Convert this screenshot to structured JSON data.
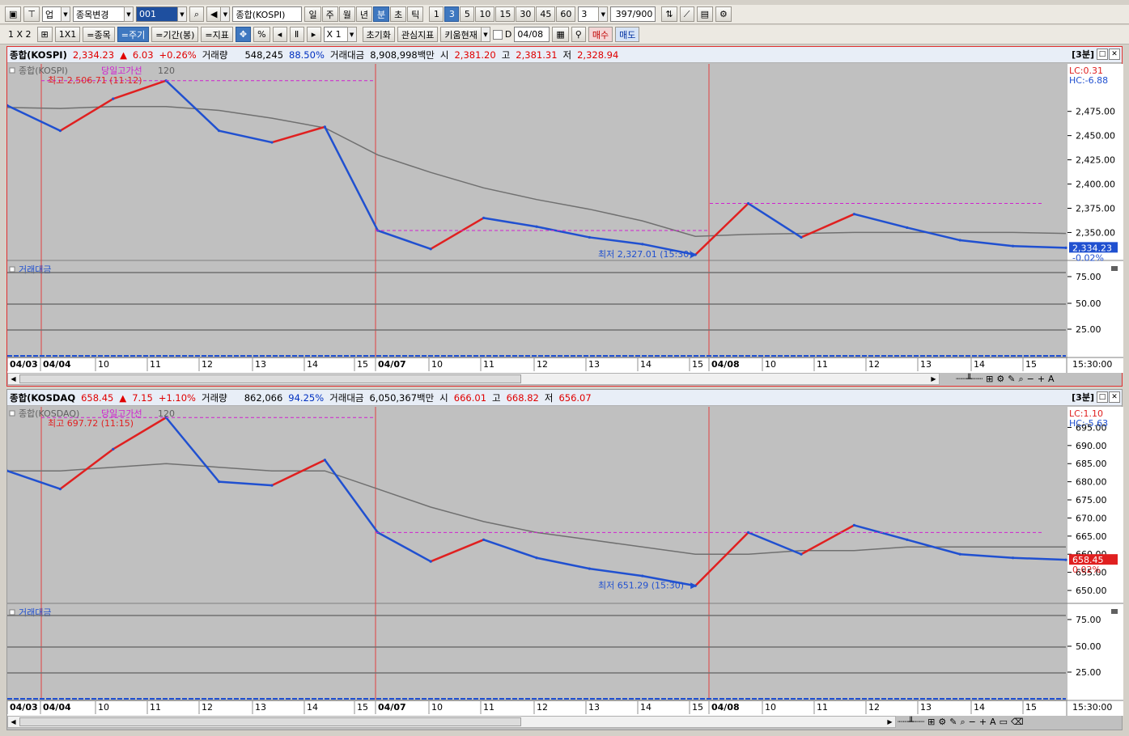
{
  "toolbar1": {
    "layout_icons": [
      "window-icon",
      "pin-icon"
    ],
    "market_type": "업",
    "code_change_label": "종목변경",
    "code_value": "001",
    "index_name": "종합(KOSPI)",
    "period_buttons": [
      "일",
      "주",
      "월",
      "년",
      "분",
      "초",
      "틱"
    ],
    "active_period": "분",
    "interval_buttons": [
      "1",
      "3",
      "5",
      "10",
      "15",
      "30",
      "45",
      "60"
    ],
    "active_interval": "3",
    "interval_select": "3",
    "count_value": "397",
    "count_total": "/900"
  },
  "toolbar2": {
    "grid_label": "1 X 2",
    "one_by_one": "1X1",
    "btn_stock": "=종목",
    "btn_period": "=주기",
    "btn_range": "=기간(봉)",
    "btn_indicator": "=지표",
    "percent_label": "%",
    "multiplier": "X 1",
    "reset_label": "초기화",
    "interest_label": "관심지표",
    "kiwoom_label": "키움현재",
    "d_label": "D",
    "date_value": "04/08",
    "buy_label": "매수",
    "sell_label": "매도"
  },
  "panels": [
    {
      "info": {
        "name": "종합(KOSPI)",
        "price": "2,334.23",
        "arrow": "▲",
        "change": "6.03",
        "change_pct": "+0.26%",
        "volume_label": "거래량",
        "volume": "548,245",
        "volume_ratio": "88.50%",
        "amount_label": "거래대금",
        "amount": "8,908,998백만",
        "open_label": "시",
        "open": "2,381.20",
        "high_label": "고",
        "high": "2,381.31",
        "low_label": "저",
        "low": "2,328.94",
        "period_tag": "[3분]"
      },
      "legend": {
        "series_name": "종합(KOSPI)",
        "line_name": "당일고가선",
        "ma": "120"
      },
      "hi_note": "최고 2,506.71 (11:12)",
      "lo_note": "최저 2,327.01 (15:30)",
      "lc_label": "LC:0.31",
      "hc_label": "HC:-6.88",
      "current_tag": "2,334.23",
      "current_pct": "-0.02%",
      "price_ticks": [
        "2,475.00",
        "2,450.00",
        "2,425.00",
        "2,400.00",
        "2,375.00",
        "2,350.00"
      ],
      "sub_label": "거래대금",
      "sub_ticks": [
        "75.00",
        "50.00",
        "25.00"
      ],
      "time_label": "15:30:00"
    },
    {
      "info": {
        "name": "종합(KOSDAQ",
        "price": "658.45",
        "arrow": "▲",
        "change": "7.15",
        "change_pct": "+1.10%",
        "volume_label": "거래량",
        "volume": "862,066",
        "volume_ratio": "94.25%",
        "amount_label": "거래대금",
        "amount": "6,050,367백만",
        "open_label": "시",
        "open": "666.01",
        "high_label": "고",
        "high": "668.82",
        "low_label": "저",
        "low": "656.07",
        "period_tag": "[3분]"
      },
      "legend": {
        "series_name": "종합(KOSDAQ)",
        "line_name": "당일고가선",
        "ma": "120"
      },
      "hi_note": "최고 697.72 (11:15)",
      "lo_note": "최저 651.29 (15:30)",
      "lc_label": "LC:1.10",
      "hc_label": "HC:-5.63",
      "current_tag": "658.45",
      "current_pct": "0.02%",
      "price_ticks": [
        "695.00",
        "690.00",
        "685.00",
        "680.00",
        "675.00",
        "670.00",
        "665.00",
        "660.00",
        "655.00",
        "650.00"
      ],
      "sub_label": "거래대금",
      "sub_ticks": [
        "75.00",
        "50.00",
        "25.00"
      ],
      "time_label": "15:30:00"
    }
  ],
  "x_axis_labels": [
    "04/03",
    "04/04",
    "10",
    "11",
    "12",
    "13",
    "14",
    "15",
    "04/07",
    "10",
    "11",
    "12",
    "13",
    "14",
    "15",
    "04/08",
    "10",
    "11",
    "12",
    "13",
    "14",
    "15"
  ],
  "colors": {
    "up": "#e02020",
    "down": "#2050d0",
    "ma": "#707070",
    "high_line": "#d020d0",
    "day_sep": "#e04040",
    "chart_bg": "#c0c0c0",
    "axis_bg": "#ffffff"
  },
  "chart_data": [
    {
      "type": "line",
      "title": "종합(KOSPI)",
      "series": [
        {
          "name": "종합(KOSPI)",
          "x": [
            "04/03 15:30",
            "04/04 09:00",
            "04/04 10:30",
            "04/04 11:12",
            "04/04 12:00",
            "04/04 13:30",
            "04/04 15:30",
            "04/07 09:00",
            "04/07 10:00",
            "04/07 11:00",
            "04/07 12:00",
            "04/07 13:00",
            "04/07 14:00",
            "04/07 15:30",
            "04/08 09:00",
            "04/08 10:00",
            "04/08 11:00",
            "04/08 12:00",
            "04/08 13:00",
            "04/08 14:00",
            "04/08 15:30"
          ],
          "values": [
            2481,
            2455,
            2488,
            2506.71,
            2455,
            2443,
            2459,
            2352,
            2333,
            2365,
            2356,
            2345,
            2338,
            2327.01,
            2380,
            2345,
            2369,
            2355,
            2342,
            2336,
            2334.23
          ]
        },
        {
          "name": "120",
          "values": [
            2479,
            2478,
            2480,
            2480,
            2476,
            2468,
            2458,
            2430,
            2412,
            2396,
            2384,
            2374,
            2362,
            2346,
            2348,
            2349,
            2350,
            2350,
            2350,
            2350,
            2349
          ]
        }
      ],
      "ylim": [
        2327,
        2514
      ]
    },
    {
      "type": "line",
      "title": "종합(KOSDAQ)",
      "series": [
        {
          "name": "종합(KOSDAQ)",
          "x": [
            "04/03 15:30",
            "04/04 09:00",
            "04/04 10:30",
            "04/04 11:15",
            "04/04 12:00",
            "04/04 13:30",
            "04/04 15:30",
            "04/07 09:00",
            "04/07 10:00",
            "04/07 11:00",
            "04/07 12:00",
            "04/07 13:00",
            "04/07 14:00",
            "04/07 15:30",
            "04/08 09:00",
            "04/08 10:00",
            "04/08 11:00",
            "04/08 12:00",
            "04/08 13:00",
            "04/08 14:00",
            "04/08 15:30"
          ],
          "values": [
            683,
            678,
            689,
            697.72,
            680,
            679,
            686,
            666,
            658,
            664,
            659,
            656,
            654,
            651.29,
            666,
            660,
            668,
            664,
            660,
            659,
            658.45
          ]
        },
        {
          "name": "120",
          "values": [
            683,
            683,
            684,
            685,
            684,
            683,
            683,
            678,
            673,
            669,
            666,
            664,
            662,
            660,
            660,
            661,
            661,
            662,
            662,
            662,
            662
          ]
        }
      ],
      "ylim": [
        648,
        698
      ]
    }
  ]
}
